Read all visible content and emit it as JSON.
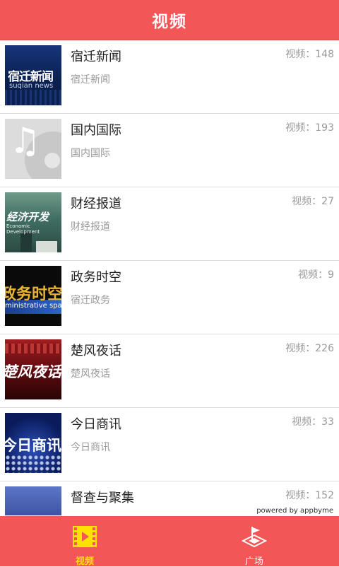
{
  "header": {
    "title": "视频"
  },
  "list": {
    "items": [
      {
        "title": "宿迁新闻",
        "subtitle": "宿迁新闻",
        "count": "视频：148",
        "thumb_text": "宿迁新闻",
        "thumb_sub": "suqian news",
        "thumb_icon": "news-thumbnail"
      },
      {
        "title": "国内国际",
        "subtitle": "国内国际",
        "count": "视频：193",
        "thumb_icon": "music-note-placeholder-icon"
      },
      {
        "title": "财经报道",
        "subtitle": "财经报道",
        "count": "视频：27",
        "thumb_text": "经济开发",
        "thumb_sub": "Economic Development",
        "thumb_icon": "finance-thumbnail"
      },
      {
        "title": "政务时空",
        "subtitle": "宿迁政务",
        "count": "视频：9",
        "thumb_text": "政务时空",
        "thumb_sub": "ministrative spac",
        "thumb_icon": "government-thumbnail"
      },
      {
        "title": "楚风夜话",
        "subtitle": "楚风夜话",
        "count": "视频：226",
        "thumb_text": "楚风夜话",
        "thumb_icon": "chufeng-thumbnail"
      },
      {
        "title": "今日商讯",
        "subtitle": "今日商讯",
        "count": "视频：33",
        "thumb_text": "今日商讯",
        "thumb_icon": "business-thumbnail"
      },
      {
        "title": "督查与聚集",
        "subtitle": "",
        "count": "视频：152",
        "thumb_icon": "supervision-thumbnail"
      }
    ]
  },
  "footer": {
    "powered_by": "powered by appbyme"
  },
  "tabbar": {
    "tabs": [
      {
        "label": "视频",
        "icon": "video-film-icon",
        "active": true,
        "color": "#ffe200"
      },
      {
        "label": "广场",
        "icon": "square-flag-icon",
        "active": false,
        "color": "#ffffff"
      }
    ]
  },
  "colors": {
    "accent": "#f25656",
    "active_tab": "#ffe200"
  }
}
